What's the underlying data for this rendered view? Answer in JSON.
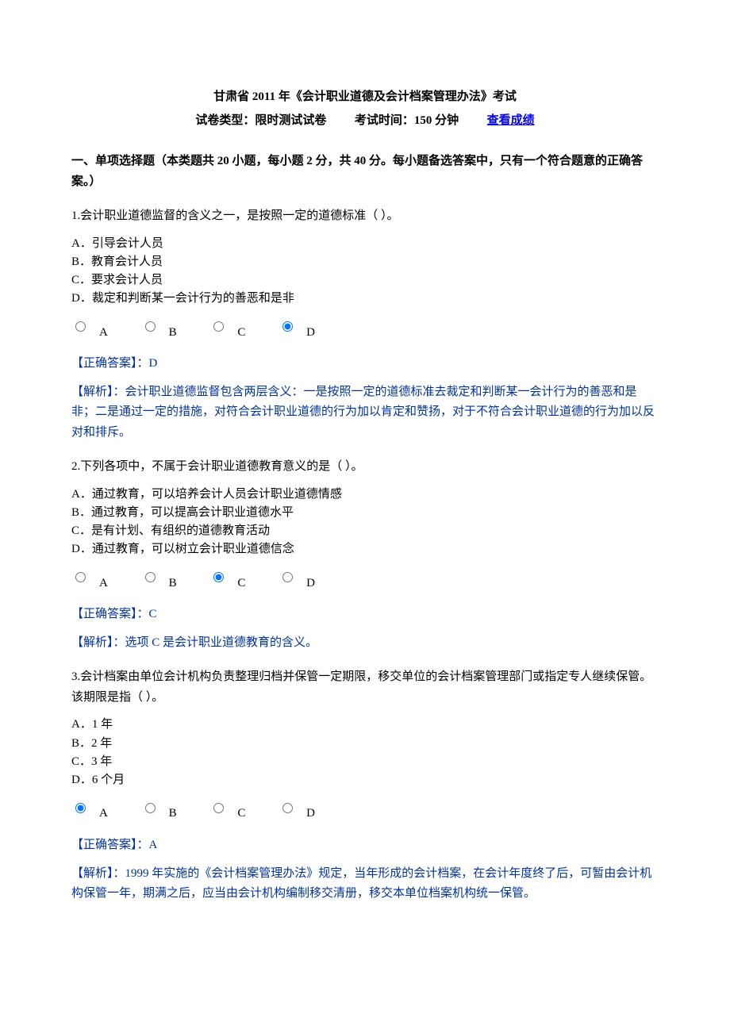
{
  "header": {
    "title": "甘肃省 2011 年《会计职业道德及会计档案管理办法》考试",
    "type_label": "试卷类型：限时测试试卷",
    "time_label": "考试时间：150 分钟",
    "link": "查看成绩"
  },
  "section": "一、单项选择题（本类题共 20 小题，每小题 2 分，共 40 分。每小题备选答案中，只有一个符合题意的正确答案。）",
  "questions": [
    {
      "stem": "1.会计职业道德监督的含义之一，是按照一定的道德标准（ ）。",
      "opts": {
        "A": "A．引导会计人员",
        "B": "B．教育会计人员",
        "C": "C．要求会计人员",
        "D": "D．裁定和判断某一会计行为的善恶和是非"
      },
      "selected": "D",
      "answer": "【正确答案】：D",
      "analysis": "【解析】：会计职业道德监督包含两层含义：一是按照一定的道德标准去裁定和判断某一会计行为的善恶和是非；二是通过一定的措施，对符合会计职业道德的行为加以肯定和赞扬，对于不符合会计职业道德的行为加以反对和排斥。"
    },
    {
      "stem": "2.下列各项中，不属于会计职业道德教育意义的是（ ）。",
      "opts": {
        "A": "A．通过教育，可以培养会计人员会计职业道德情感",
        "B": "B．通过教育，可以提高会计职业道德水平",
        "C": "C．是有计划、有组织的道德教育活动",
        "D": "D．通过教育，可以树立会计职业道德信念"
      },
      "selected": "C",
      "answer": "【正确答案】：C",
      "analysis": "【解析】：选项 C 是会计职业道德教育的含义。"
    },
    {
      "stem": "3.会计档案由单位会计机构负责整理归档并保管一定期限，移交单位的会计档案管理部门或指定专人继续保管。该期限是指（ ）。",
      "opts": {
        "A": "A．1 年",
        "B": "B．2 年",
        "C": "C．3 年",
        "D": "D．6 个月"
      },
      "selected": "A",
      "answer": "【正确答案】：A",
      "analysis": "【解析】：1999 年实施的《会计档案管理办法》规定，当年形成的会计档案，在会计年度终了后，可暂由会计机构保管一年，期满之后，应当由会计机构编制移交清册，移交本单位档案机构统一保管。"
    }
  ],
  "radio_labels": {
    "A": "A",
    "B": "B",
    "C": "C",
    "D": "D"
  }
}
